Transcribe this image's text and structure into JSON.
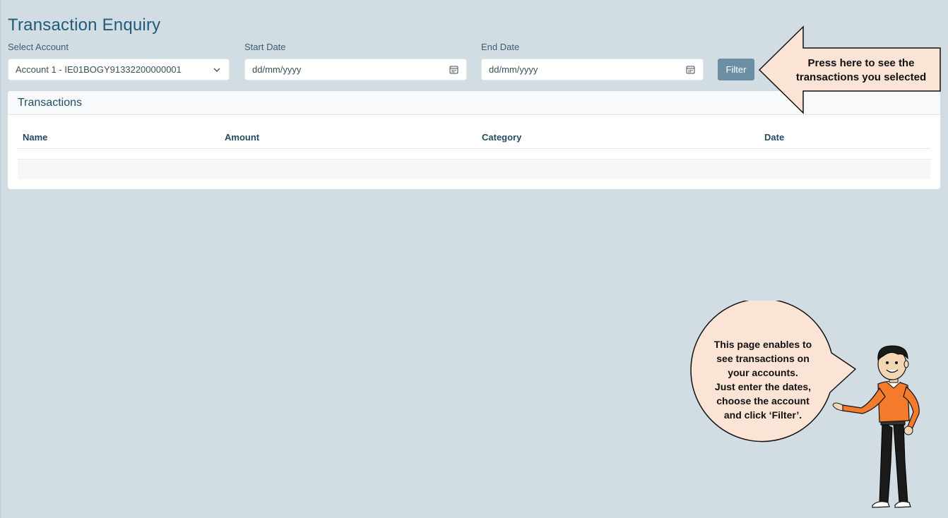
{
  "page": {
    "title": "Transaction Enquiry"
  },
  "filters": {
    "account_label": "Select Account",
    "account_value": "Account 1 - IE01BOGY91332200000001",
    "start_label": "Start Date",
    "start_placeholder": "dd/mm/yyyy",
    "end_label": "End Date",
    "end_placeholder": "dd/mm/yyyy",
    "filter_label": "Filter"
  },
  "transactions": {
    "title": "Transactions",
    "columns": [
      "Name",
      "Amount",
      "Category",
      "Date"
    ],
    "rows": []
  },
  "callouts": {
    "filter_hint": "Press here to see the transactions you selected",
    "guide_line1": "This page enables to",
    "guide_line2": "see transactions on",
    "guide_line3": "your accounts.",
    "guide_line4": "Just enter the dates,",
    "guide_line5": "choose the account",
    "guide_line6": "and click ‘Filter’."
  },
  "colors": {
    "background": "#d2dde3",
    "accent": "#1f5b7a",
    "button": "#6c8ea3",
    "callout_fill": "#fbe3d6",
    "shirt": "#f47a2c"
  },
  "icons": {
    "account_dropdown": "chevron-down-icon",
    "start_date": "calendar-icon",
    "end_date": "calendar-icon"
  }
}
